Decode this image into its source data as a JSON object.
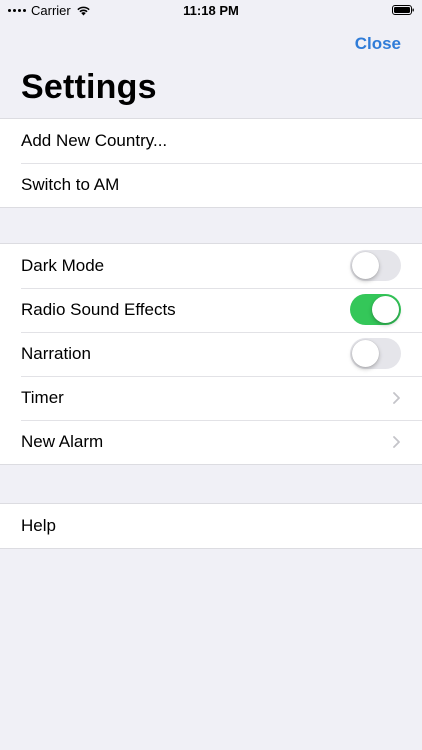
{
  "status_bar": {
    "carrier": "Carrier",
    "time": "11:18 PM"
  },
  "nav": {
    "close_label": "Close",
    "title": "Settings"
  },
  "groups": [
    {
      "items": [
        {
          "label": "Add New Country..."
        },
        {
          "label": "Switch to AM"
        }
      ]
    },
    {
      "items": [
        {
          "label": "Dark Mode",
          "toggle": false
        },
        {
          "label": "Radio Sound Effects",
          "toggle": true
        },
        {
          "label": "Narration",
          "toggle": false
        },
        {
          "label": "Timer",
          "accessory": "chevron-right-icon"
        },
        {
          "label": "New Alarm",
          "accessory": "chevron-right-icon"
        }
      ]
    },
    {
      "items": [
        {
          "label": "Help"
        }
      ]
    }
  ],
  "colors": {
    "accent": "#2f7cd8",
    "toggle_on": "#34c759",
    "toggle_off": "#e5e5ea",
    "background": "#f0f0f6"
  }
}
